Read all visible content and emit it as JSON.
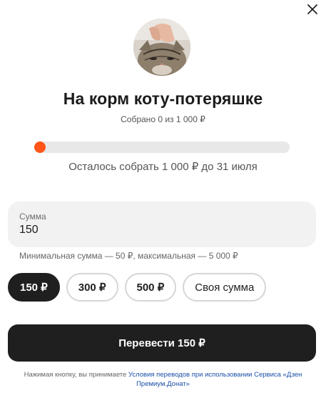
{
  "modal": {
    "close_icon": "close-icon",
    "avatar_icon": "cat-photo"
  },
  "fundraiser": {
    "title": "На корм коту-потеряшке",
    "collected_text": "Собрано 0 из 1 000 ₽",
    "progress_fraction": 0,
    "remaining_text": "Осталось собрать 1 000 ₽ до 31 июля",
    "accent_color": "#ff5518"
  },
  "amount_input": {
    "label": "Сумма",
    "value": "150"
  },
  "limits_text": "Минимальная сумма — 50 ₽, максимальная — 5 000 ₽",
  "chips": [
    {
      "label": "150 ₽",
      "active": true
    },
    {
      "label": "300 ₽",
      "active": false
    },
    {
      "label": "500 ₽",
      "active": false
    },
    {
      "label": "Своя сумма",
      "active": false
    }
  ],
  "submit_label": "Перевести 150 ₽",
  "terms": {
    "prefix": "Нажимая кнопку, вы принимаете ",
    "link_text": "Условия переводов при использовании Сервиса «Дзен Премиум.Донат»"
  }
}
